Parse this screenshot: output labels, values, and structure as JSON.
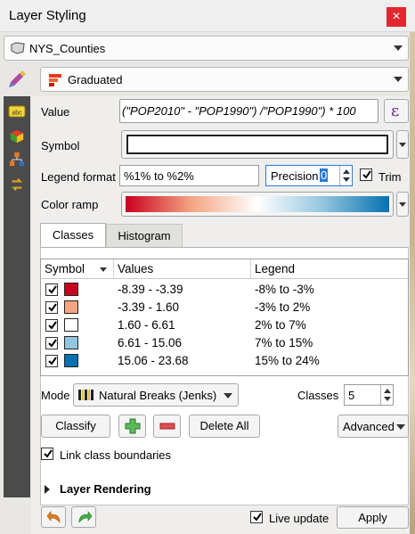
{
  "window": {
    "title": "Layer Styling",
    "close_label": "×"
  },
  "layer": {
    "name": "NYS_Counties"
  },
  "renderer": {
    "type": "Graduated"
  },
  "form": {
    "value_label": "Value",
    "value_expression": "(\"POP2010\" - \"POP1990\") /\"POP1990\") * 100",
    "symbol_label": "Symbol",
    "legend_format_label": "Legend format",
    "legend_format_value": "%1% to %2%",
    "precision_label": "Precision",
    "precision_value": "0",
    "trim_label": "Trim",
    "color_ramp_label": "Color ramp",
    "color_ramp_colors": [
      "#ca0020",
      "#f4a582",
      "#ffffff",
      "#92c5de",
      "#0571b0"
    ]
  },
  "tabs": [
    {
      "label": "Classes",
      "active": true
    },
    {
      "label": "Histogram",
      "active": false
    }
  ],
  "table": {
    "headers": [
      "Symbol",
      "Values",
      "Legend"
    ],
    "rows": [
      {
        "checked": true,
        "color": "#ca0020",
        "values": "-8.39 - -3.39",
        "legend": "-8% to -3%"
      },
      {
        "checked": true,
        "color": "#f4a582",
        "values": "-3.39 - 1.60",
        "legend": "-3% to 2%"
      },
      {
        "checked": true,
        "color": "#ffffff",
        "values": "1.60 - 6.61",
        "legend": "2% to 7%"
      },
      {
        "checked": true,
        "color": "#92c5de",
        "values": "6.61 - 15.06",
        "legend": "7% to 15%"
      },
      {
        "checked": true,
        "color": "#0571b0",
        "values": "15.06 - 23.68",
        "legend": "15% to 24%"
      }
    ]
  },
  "mode": {
    "label": "Mode",
    "value": "Natural Breaks (Jenks)",
    "classes_label": "Classes",
    "classes_value": "5"
  },
  "buttons": {
    "classify": "Classify",
    "delete_all": "Delete All",
    "advanced": "Advanced",
    "apply": "Apply"
  },
  "link_boundaries": {
    "label": "Link class boundaries",
    "checked": true
  },
  "layer_rendering": {
    "label": "Layer Rendering"
  },
  "live_update": {
    "label": "Live update",
    "checked": true
  },
  "icons": [
    "brush-icon",
    "label-icon",
    "cube-icon",
    "diagram-icon",
    "style-history-icon",
    "undo-icon",
    "redo-icon",
    "add-class-icon",
    "remove-class-icon",
    "expression-icon"
  ]
}
